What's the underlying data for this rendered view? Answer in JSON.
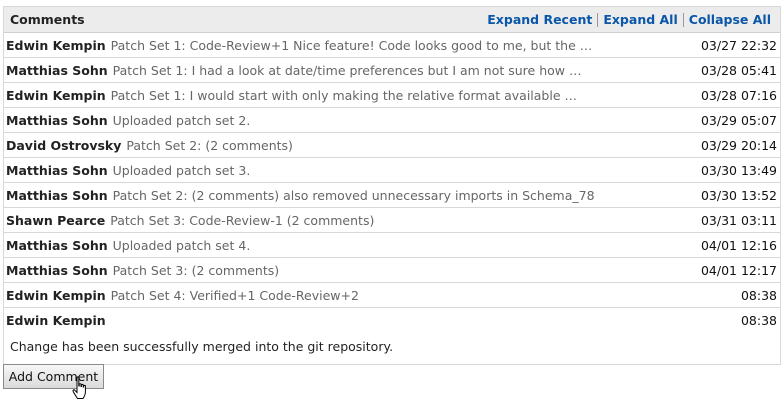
{
  "header": {
    "title": "Comments",
    "expand_recent": "Expand Recent",
    "expand_all": "Expand All",
    "collapse_all": "Collapse All"
  },
  "comments": [
    {
      "author": "Edwin Kempin",
      "summary": "Patch Set 1: Code-Review+1 Nice feature! Code looks good to me, but the …",
      "date": "03/27 22:32"
    },
    {
      "author": "Matthias Sohn",
      "summary": "Patch Set 1: I had a look at date/time preferences but I am not sure how …",
      "date": "03/28 05:41"
    },
    {
      "author": "Edwin Kempin",
      "summary": "Patch Set 1: I would start with only making the relative format available …",
      "date": "03/28 07:16"
    },
    {
      "author": "Matthias Sohn",
      "summary": "Uploaded patch set 2.",
      "date": "03/29 05:07"
    },
    {
      "author": "David Ostrovsky",
      "summary": "Patch Set 2: (2 comments)",
      "date": "03/29 20:14"
    },
    {
      "author": "Matthias Sohn",
      "summary": "Uploaded patch set 3.",
      "date": "03/30 13:49"
    },
    {
      "author": "Matthias Sohn",
      "summary": "Patch Set 2: (2 comments) also removed unnecessary imports in Schema_78",
      "date": "03/30 13:52"
    },
    {
      "author": "Shawn Pearce",
      "summary": "Patch Set 3: Code-Review-1 (2 comments)",
      "date": "03/31 03:11"
    },
    {
      "author": "Matthias Sohn",
      "summary": "Uploaded patch set 4.",
      "date": "04/01 12:16"
    },
    {
      "author": "Matthias Sohn",
      "summary": "Patch Set 3: (2 comments)",
      "date": "04/01 12:17"
    },
    {
      "author": "Edwin Kempin",
      "summary": "Patch Set 4: Verified+1 Code-Review+2",
      "date": "08:38"
    }
  ],
  "expanded_comment": {
    "author": "Edwin Kempin",
    "date": "08:38",
    "message": "Change has been successfully merged into the git repository."
  },
  "add_comment_label": "Add Comment",
  "cursor_icon": "hand-pointer-icon"
}
